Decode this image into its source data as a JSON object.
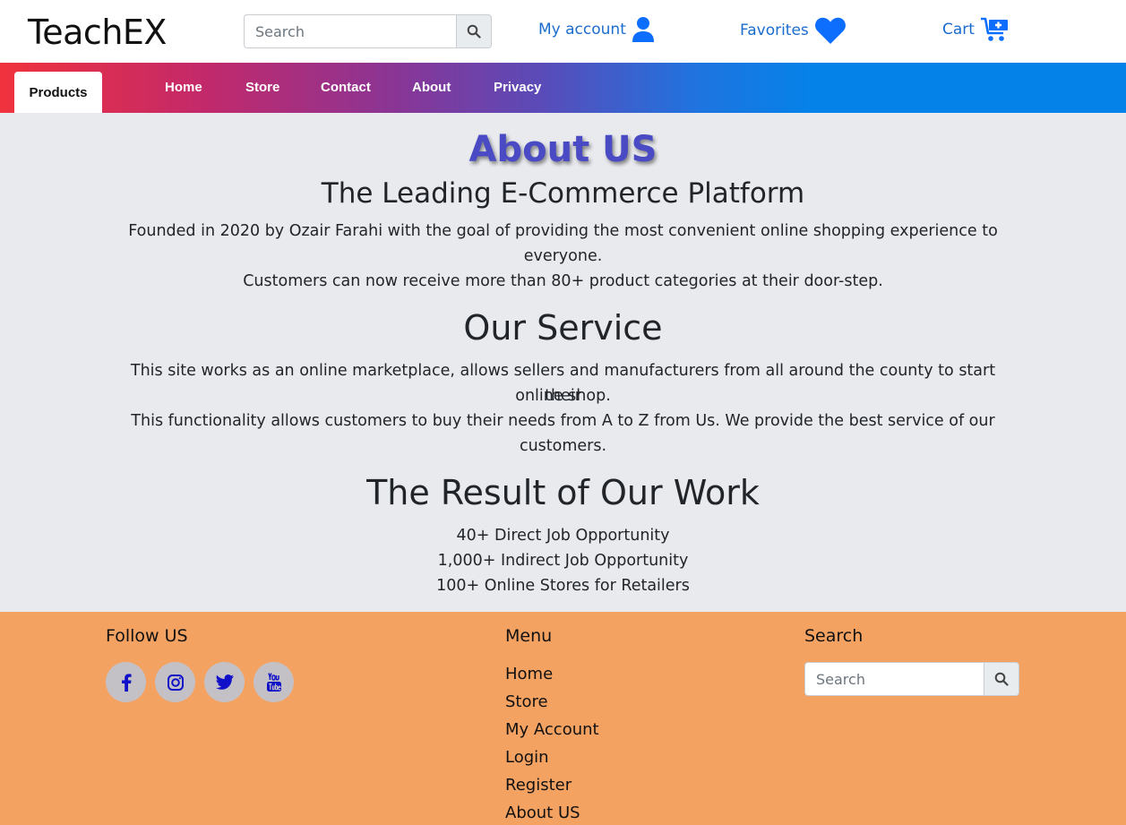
{
  "header": {
    "brand": "TeachEX",
    "search_placeholder": "Search",
    "my_account": "My account",
    "favorites": "Favorites",
    "cart": "Cart"
  },
  "nav": {
    "active": "Products",
    "items": [
      "Home",
      "Store",
      "Contact",
      "About",
      "Privacy"
    ]
  },
  "main": {
    "title": "About US",
    "section1": {
      "heading": "The Leading E-Commerce Platform",
      "line1a": "Founded in 2020 by Ozair Farahi with the goal of providing the most convenient online shopping experience to",
      "line1b": "everyone.",
      "line2": "Customers can now receive more than 80+ product categories at their door-step."
    },
    "section2": {
      "heading": "Our Service",
      "line1a": "This site works as an online marketplace, allows sellers and manufacturers from all around the county to start their",
      "line1b": "online shop.",
      "line2a": "This functionality allows customers to buy their needs from A to Z from Us. We provide the best service of our",
      "line2b": "customers."
    },
    "section3": {
      "heading": "The Result of Our Work",
      "items": [
        "40+ Direct Job Opportunity",
        "1,000+ Indirect Job Opportunity",
        "100+ Online Stores for Retailers"
      ]
    }
  },
  "footer": {
    "follow_heading": "Follow US",
    "menu_heading": "Menu",
    "search_heading": "Search",
    "search_placeholder": "Search",
    "menu_items": [
      "Home",
      "Store",
      "My Account",
      "Login",
      "Register",
      "About US"
    ],
    "social": [
      "facebook-icon",
      "instagram-icon",
      "twitter-icon",
      "youtube-icon"
    ]
  },
  "colors": {
    "accent_blue": "#0d6efd",
    "title_purple": "#4a4ac4",
    "footer_bg": "#f4a261",
    "social_icon": "#1010c8"
  }
}
